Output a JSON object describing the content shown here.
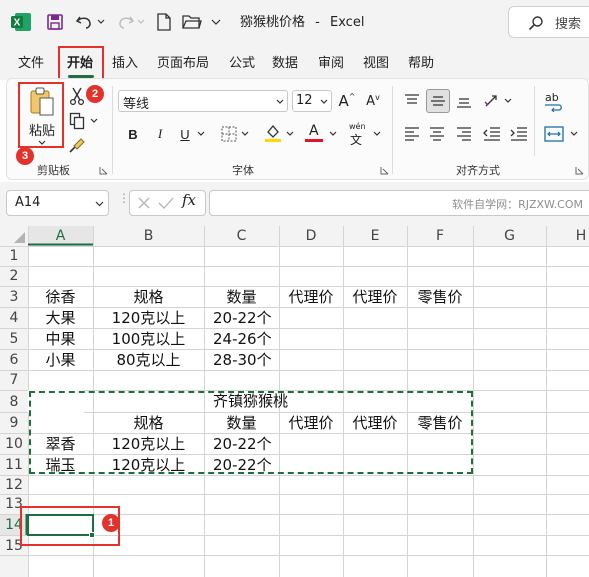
{
  "titlebar": {
    "doc_title": "猕猴桃价格",
    "sep": "-",
    "app_name": "Excel",
    "search_label": "搜索"
  },
  "tabs": [
    "文件",
    "开始",
    "插入",
    "页面布局",
    "公式",
    "数据",
    "审阅",
    "视图",
    "帮助"
  ],
  "ribbon": {
    "paste_label": "粘贴",
    "clipboard_group": "剪贴板",
    "font_name": "等线",
    "font_size": "12",
    "font_group": "字体",
    "align_group": "对齐方式",
    "bold": "B",
    "italic": "I",
    "underline": "U",
    "font_color_letter": "A",
    "wen_label": "wén",
    "wen_char": "文",
    "grow_font": "A",
    "shrink_font": "A",
    "wrap_label": "ab",
    "fx": "fx"
  },
  "formula": {
    "name_box": "A14",
    "watermark": "软件自学网：RJZXW.COM"
  },
  "columns": [
    "A",
    "B",
    "C",
    "D",
    "E",
    "F",
    "G",
    "H"
  ],
  "rows": [
    "1",
    "2",
    "3",
    "4",
    "5",
    "6",
    "7",
    "8",
    "9",
    "10",
    "11",
    "12",
    "13",
    "14",
    "15"
  ],
  "cells": {
    "r3": [
      "徐香",
      "规格",
      "数量",
      "代理价",
      "代理价",
      "零售价"
    ],
    "r4": [
      "大果",
      "120克以上",
      "20-22个"
    ],
    "r5": [
      "中果",
      "100克以上",
      "24-26个"
    ],
    "r6": [
      "小果",
      "80克以上",
      "28-30个"
    ],
    "r8_title": "齐镇猕猴桃",
    "r9": [
      "规格",
      "数量",
      "代理价",
      "代理价",
      "零售价"
    ],
    "r10": [
      "翠香",
      "120克以上",
      "20-22个"
    ],
    "r11": [
      "瑞玉",
      "120克以上",
      "20-22个"
    ]
  },
  "markers": [
    "1",
    "2",
    "3"
  ],
  "colors": {
    "excel_green": "#1d6f42",
    "marker_red": "#e2322b",
    "font_red": "#e81123",
    "highlight_yellow": "#ffd800"
  }
}
